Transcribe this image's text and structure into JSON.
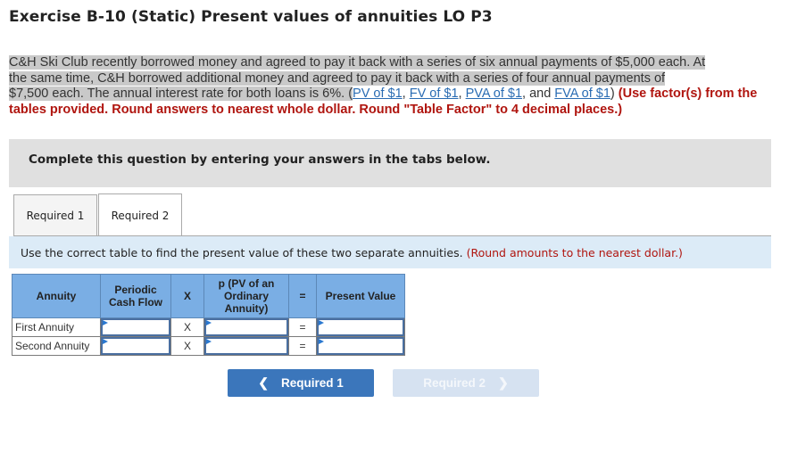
{
  "title": "Exercise B-10 (Static) Present values of annuities LO P3",
  "problem": {
    "line1": "C&H Ski Club recently borrowed money and agreed to pay it back with a series of six annual payments of $5,000 each. At",
    "line2": "the same time, C&H borrowed additional money and agreed to pay it back with a series of four annual payments of",
    "line3_start": "$7,500 each. The annual interest rate for both loans is 6%. (",
    "links": [
      "PV of $1",
      "FV of $1",
      "PVA of $1",
      "FVA of $1"
    ],
    "sep1": ", ",
    "sep2": ", ",
    "sep3": ", and ",
    "close": ")",
    "instruction_red": " (Use factor(s) from the tables provided. Round answers to nearest whole dollar. Round \"Table Factor\" to 4 decimal places.)"
  },
  "instruction_box": "Complete this question by entering your answers in the tabs below.",
  "tabs": [
    {
      "label": "Required 1",
      "active": false
    },
    {
      "label": "Required 2",
      "active": true
    }
  ],
  "panel": {
    "text": "Use the correct table to find the present value of these two separate annuities. ",
    "note": "(Round amounts to the nearest dollar.)"
  },
  "table": {
    "headers": [
      "Annuity",
      "Periodic Cash Flow",
      "X",
      "p (PV of an Ordinary Annuity)",
      "=",
      "Present Value"
    ],
    "rows": [
      {
        "label": "First Annuity",
        "op1": "X",
        "op2": "=",
        "cash_flow": "",
        "factor": "",
        "present_value": ""
      },
      {
        "label": "Second Annuity",
        "op1": "X",
        "op2": "=",
        "cash_flow": "",
        "factor": "",
        "present_value": ""
      }
    ]
  },
  "nav": {
    "prev_label": "Required 1",
    "next_label": "Required 2",
    "prev_icon": "chevron-left-icon",
    "next_icon": "chevron-right-icon"
  }
}
